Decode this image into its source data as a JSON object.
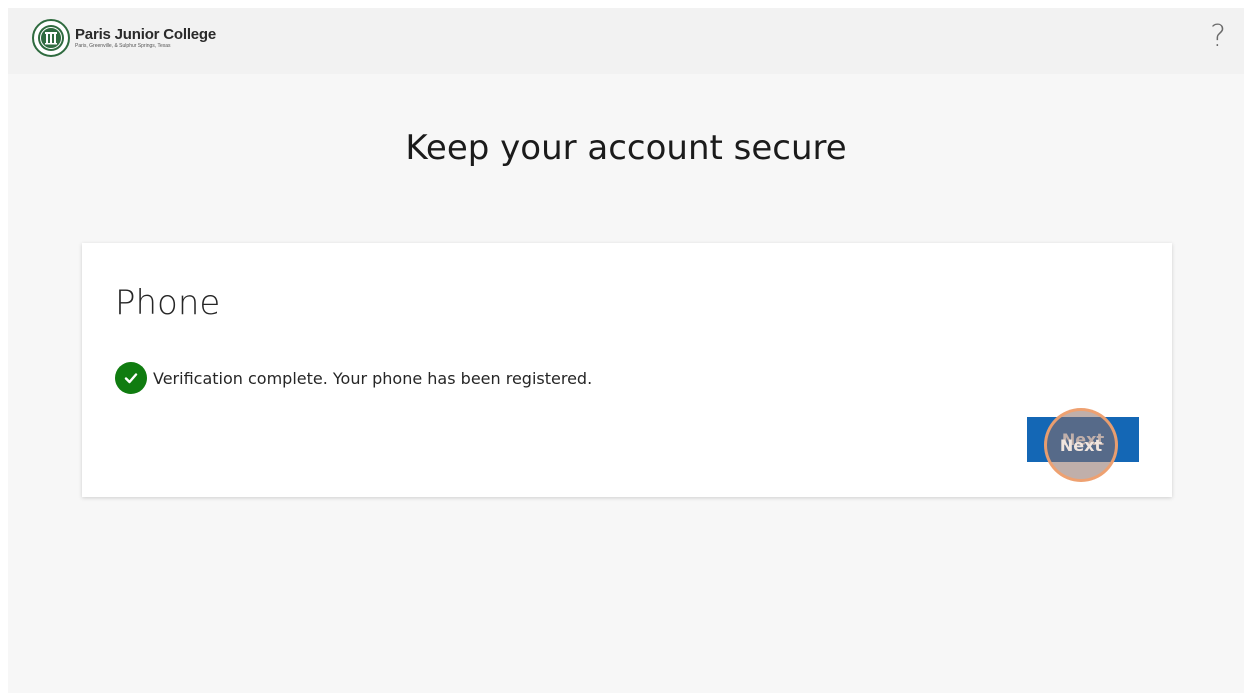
{
  "header": {
    "logo_name": "Paris Junior College",
    "logo_tagline": "Paris, Greenville, & Sulphur Springs, Texas",
    "help_label": "?"
  },
  "page": {
    "title": "Keep your account secure"
  },
  "card": {
    "title": "Phone",
    "status_icon": "check-circle-icon",
    "status_text": "Verification complete. Your phone has been registered.",
    "next_label": "Next"
  },
  "colors": {
    "primary_button": "#1467b5",
    "success": "#107c10",
    "brand_green": "#2f6b3f",
    "click_indicator": "#f0a06e"
  }
}
